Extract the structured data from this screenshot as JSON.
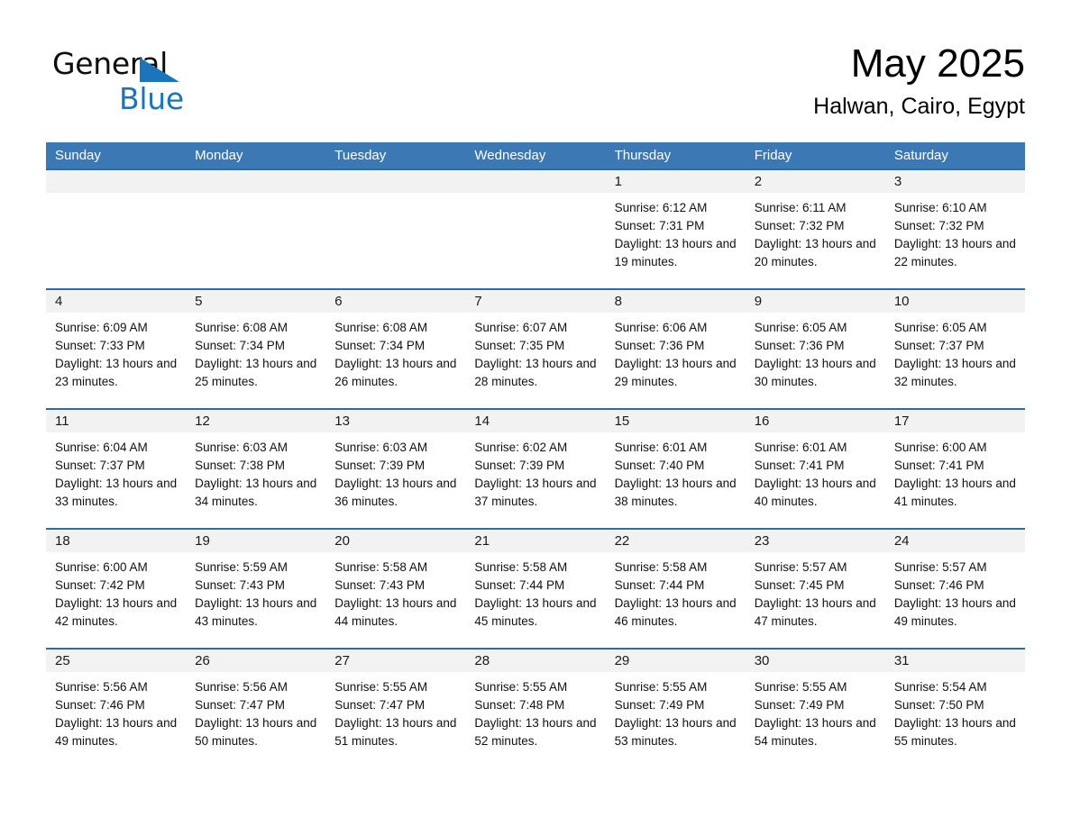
{
  "logo": {
    "word_one": "General",
    "word_two": "Blue",
    "triangle_color": "#1b75bb"
  },
  "header": {
    "title": "May 2025",
    "subtitle": "Halwan, Cairo, Egypt"
  },
  "theme": {
    "header_blue": "#3c78b4",
    "row_rule_blue": "#2e6ca4",
    "day_band_gray": "#f2f2f2",
    "text_black": "#111111"
  },
  "calendar": {
    "day_names": [
      "Sunday",
      "Monday",
      "Tuesday",
      "Wednesday",
      "Thursday",
      "Friday",
      "Saturday"
    ],
    "labels": {
      "sunrise_prefix": "Sunrise:",
      "sunset_prefix": "Sunset:",
      "daylight_prefix": "Daylight:"
    },
    "weeks": [
      [
        {
          "day": "",
          "empty": true
        },
        {
          "day": "",
          "empty": true
        },
        {
          "day": "",
          "empty": true
        },
        {
          "day": "",
          "empty": true
        },
        {
          "day": "1",
          "sunrise": "Sunrise: 6:12 AM",
          "sunset": "Sunset: 7:31 PM",
          "daylight": "Daylight: 13 hours and 19 minutes."
        },
        {
          "day": "2",
          "sunrise": "Sunrise: 6:11 AM",
          "sunset": "Sunset: 7:32 PM",
          "daylight": "Daylight: 13 hours and 20 minutes."
        },
        {
          "day": "3",
          "sunrise": "Sunrise: 6:10 AM",
          "sunset": "Sunset: 7:32 PM",
          "daylight": "Daylight: 13 hours and 22 minutes."
        }
      ],
      [
        {
          "day": "4",
          "sunrise": "Sunrise: 6:09 AM",
          "sunset": "Sunset: 7:33 PM",
          "daylight": "Daylight: 13 hours and 23 minutes."
        },
        {
          "day": "5",
          "sunrise": "Sunrise: 6:08 AM",
          "sunset": "Sunset: 7:34 PM",
          "daylight": "Daylight: 13 hours and 25 minutes."
        },
        {
          "day": "6",
          "sunrise": "Sunrise: 6:08 AM",
          "sunset": "Sunset: 7:34 PM",
          "daylight": "Daylight: 13 hours and 26 minutes."
        },
        {
          "day": "7",
          "sunrise": "Sunrise: 6:07 AM",
          "sunset": "Sunset: 7:35 PM",
          "daylight": "Daylight: 13 hours and 28 minutes."
        },
        {
          "day": "8",
          "sunrise": "Sunrise: 6:06 AM",
          "sunset": "Sunset: 7:36 PM",
          "daylight": "Daylight: 13 hours and 29 minutes."
        },
        {
          "day": "9",
          "sunrise": "Sunrise: 6:05 AM",
          "sunset": "Sunset: 7:36 PM",
          "daylight": "Daylight: 13 hours and 30 minutes."
        },
        {
          "day": "10",
          "sunrise": "Sunrise: 6:05 AM",
          "sunset": "Sunset: 7:37 PM",
          "daylight": "Daylight: 13 hours and 32 minutes."
        }
      ],
      [
        {
          "day": "11",
          "sunrise": "Sunrise: 6:04 AM",
          "sunset": "Sunset: 7:37 PM",
          "daylight": "Daylight: 13 hours and 33 minutes."
        },
        {
          "day": "12",
          "sunrise": "Sunrise: 6:03 AM",
          "sunset": "Sunset: 7:38 PM",
          "daylight": "Daylight: 13 hours and 34 minutes."
        },
        {
          "day": "13",
          "sunrise": "Sunrise: 6:03 AM",
          "sunset": "Sunset: 7:39 PM",
          "daylight": "Daylight: 13 hours and 36 minutes."
        },
        {
          "day": "14",
          "sunrise": "Sunrise: 6:02 AM",
          "sunset": "Sunset: 7:39 PM",
          "daylight": "Daylight: 13 hours and 37 minutes."
        },
        {
          "day": "15",
          "sunrise": "Sunrise: 6:01 AM",
          "sunset": "Sunset: 7:40 PM",
          "daylight": "Daylight: 13 hours and 38 minutes."
        },
        {
          "day": "16",
          "sunrise": "Sunrise: 6:01 AM",
          "sunset": "Sunset: 7:41 PM",
          "daylight": "Daylight: 13 hours and 40 minutes."
        },
        {
          "day": "17",
          "sunrise": "Sunrise: 6:00 AM",
          "sunset": "Sunset: 7:41 PM",
          "daylight": "Daylight: 13 hours and 41 minutes."
        }
      ],
      [
        {
          "day": "18",
          "sunrise": "Sunrise: 6:00 AM",
          "sunset": "Sunset: 7:42 PM",
          "daylight": "Daylight: 13 hours and 42 minutes."
        },
        {
          "day": "19",
          "sunrise": "Sunrise: 5:59 AM",
          "sunset": "Sunset: 7:43 PM",
          "daylight": "Daylight: 13 hours and 43 minutes."
        },
        {
          "day": "20",
          "sunrise": "Sunrise: 5:58 AM",
          "sunset": "Sunset: 7:43 PM",
          "daylight": "Daylight: 13 hours and 44 minutes."
        },
        {
          "day": "21",
          "sunrise": "Sunrise: 5:58 AM",
          "sunset": "Sunset: 7:44 PM",
          "daylight": "Daylight: 13 hours and 45 minutes."
        },
        {
          "day": "22",
          "sunrise": "Sunrise: 5:58 AM",
          "sunset": "Sunset: 7:44 PM",
          "daylight": "Daylight: 13 hours and 46 minutes."
        },
        {
          "day": "23",
          "sunrise": "Sunrise: 5:57 AM",
          "sunset": "Sunset: 7:45 PM",
          "daylight": "Daylight: 13 hours and 47 minutes."
        },
        {
          "day": "24",
          "sunrise": "Sunrise: 5:57 AM",
          "sunset": "Sunset: 7:46 PM",
          "daylight": "Daylight: 13 hours and 49 minutes."
        }
      ],
      [
        {
          "day": "25",
          "sunrise": "Sunrise: 5:56 AM",
          "sunset": "Sunset: 7:46 PM",
          "daylight": "Daylight: 13 hours and 49 minutes."
        },
        {
          "day": "26",
          "sunrise": "Sunrise: 5:56 AM",
          "sunset": "Sunset: 7:47 PM",
          "daylight": "Daylight: 13 hours and 50 minutes."
        },
        {
          "day": "27",
          "sunrise": "Sunrise: 5:55 AM",
          "sunset": "Sunset: 7:47 PM",
          "daylight": "Daylight: 13 hours and 51 minutes."
        },
        {
          "day": "28",
          "sunrise": "Sunrise: 5:55 AM",
          "sunset": "Sunset: 7:48 PM",
          "daylight": "Daylight: 13 hours and 52 minutes."
        },
        {
          "day": "29",
          "sunrise": "Sunrise: 5:55 AM",
          "sunset": "Sunset: 7:49 PM",
          "daylight": "Daylight: 13 hours and 53 minutes."
        },
        {
          "day": "30",
          "sunrise": "Sunrise: 5:55 AM",
          "sunset": "Sunset: 7:49 PM",
          "daylight": "Daylight: 13 hours and 54 minutes."
        },
        {
          "day": "31",
          "sunrise": "Sunrise: 5:54 AM",
          "sunset": "Sunset: 7:50 PM",
          "daylight": "Daylight: 13 hours and 55 minutes."
        }
      ]
    ]
  }
}
